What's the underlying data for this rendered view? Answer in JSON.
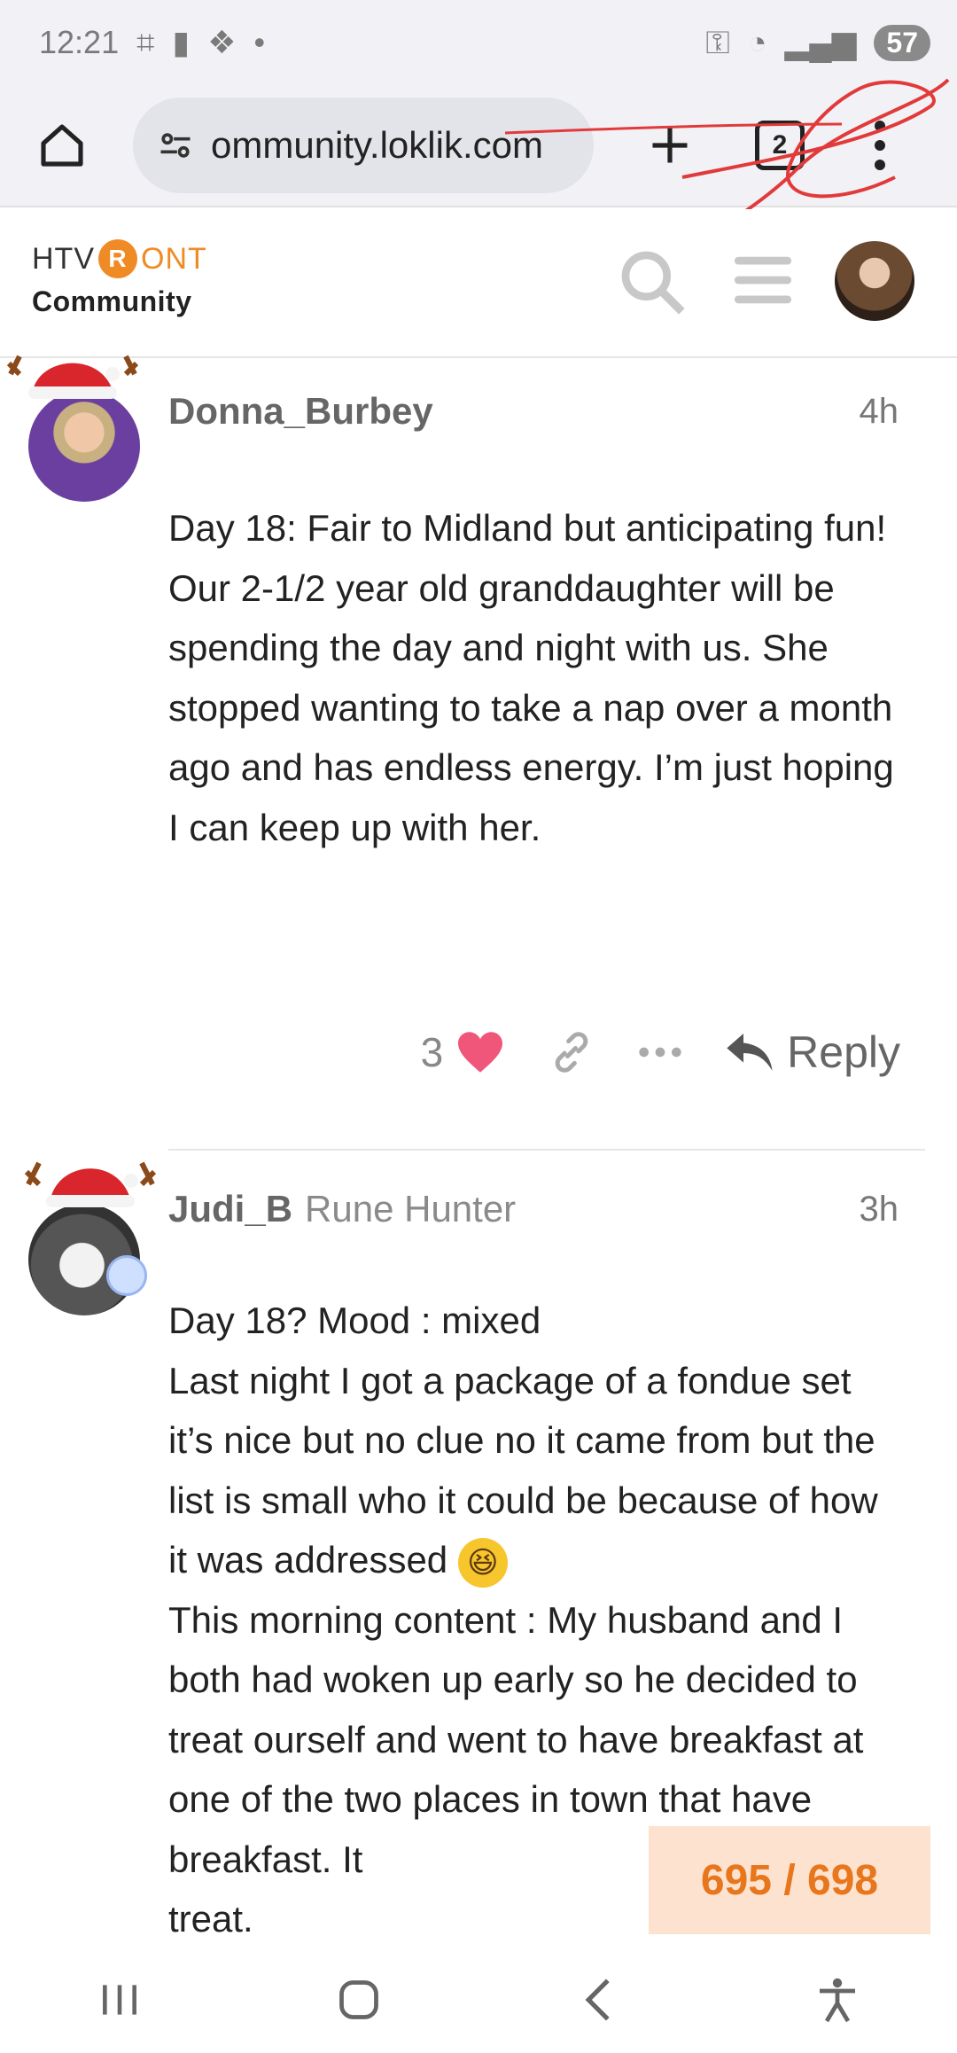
{
  "statusbar": {
    "time": "12:21",
    "battery": "57"
  },
  "browser": {
    "url": "ommunity.loklik.com",
    "tab_count": "2"
  },
  "site": {
    "logo_left": "HTV",
    "logo_mark": "R",
    "logo_right": "ONT",
    "logo_sub": "Community"
  },
  "posts": [
    {
      "username": "Donna_Burbey",
      "user_title": "",
      "time": "4h",
      "body": [
        "Day 18: Fair to Midland but anticipating fun! Our 2-1/2 year old granddaughter will be spending the day and night with us. She stopped wanting to take a nap over a month ago and has endless energy. I’m just hoping I can keep up with her."
      ],
      "likes": "3",
      "reply_label": "Reply"
    },
    {
      "username": "Judi_B",
      "user_title": "Rune Hunter",
      "time": "3h",
      "body": [
        "Day 18? Mood : mixed",
        "Last night I got a package of a fondue set it’s nice but no clue no it came from but the list is small who it could be because of how it was addressed",
        "This morning content : My husband and I both had woken up early so he decided to treat ourself and went to have breakfast at one of the two places in town that have breakfast. It",
        "treat."
      ],
      "emoji": "😆"
    }
  ],
  "progress": {
    "label": "695 / 698",
    "current": 695,
    "total": 698
  },
  "colors": {
    "accent": "#f08a24",
    "heart": "#f0567a",
    "counter_bg": "#fde3cf"
  }
}
